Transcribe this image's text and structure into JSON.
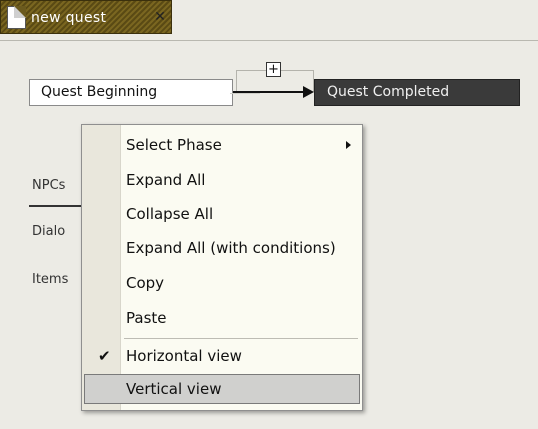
{
  "tab": {
    "title": "new quest",
    "close_glyph": "✕",
    "icon": "document-icon"
  },
  "diagram": {
    "add_glyph": "+",
    "nodes": [
      {
        "label": "Quest Beginning",
        "state": "normal"
      },
      {
        "label": "Quest Completed",
        "state": "selected"
      }
    ]
  },
  "left_panel": {
    "labels": [
      "NPCs",
      "Dialo",
      "Items"
    ]
  },
  "context_menu": {
    "items": [
      {
        "label": "Select Phase",
        "submenu": true
      },
      {
        "label": "Expand All"
      },
      {
        "label": "Collapse All"
      },
      {
        "label": "Expand All (with conditions)"
      },
      {
        "label": "Copy"
      },
      {
        "label": "Paste"
      },
      {
        "label": "Horizontal view",
        "checked": true,
        "check_glyph": "✔"
      },
      {
        "label": "Vertical view",
        "highlighted": true
      }
    ]
  },
  "colors": {
    "tab_bg": "#6b5a1e",
    "menu_bg": "#fbfbf2",
    "selected_node": "#3a3a3a",
    "highlight": "#d0d0ce"
  }
}
